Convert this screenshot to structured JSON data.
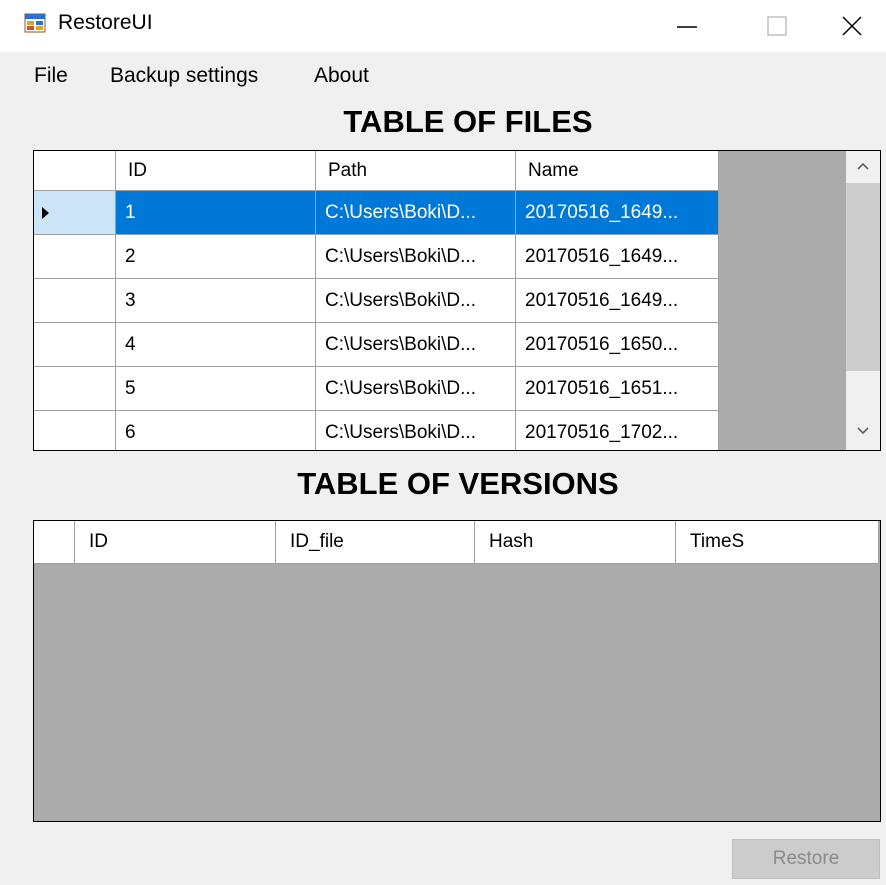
{
  "window": {
    "title": "RestoreUI",
    "icon": "app-form-icon"
  },
  "titlebar_buttons": {
    "minimize_icon": "minimize-icon",
    "maximize_icon": "maximize-icon",
    "close_icon": "close-icon"
  },
  "menu": [
    "File",
    "Backup settings",
    "About"
  ],
  "files": {
    "heading": "TABLE OF FILES",
    "columns": [
      "ID",
      "Path",
      "Name"
    ],
    "rows": [
      [
        "1",
        "C:\\Users\\Boki\\D...",
        "20170516_1649..."
      ],
      [
        "2",
        "C:\\Users\\Boki\\D...",
        "20170516_1649..."
      ],
      [
        "3",
        "C:\\Users\\Boki\\D...",
        "20170516_1649..."
      ],
      [
        "4",
        "C:\\Users\\Boki\\D...",
        "20170516_1650..."
      ],
      [
        "5",
        "C:\\Users\\Boki\\D...",
        "20170516_1651..."
      ],
      [
        "6",
        "C:\\Users\\Boki\\D...",
        "20170516_1702..."
      ]
    ],
    "selected_row": 0
  },
  "versions": {
    "heading": "TABLE OF VERSIONS",
    "columns": [
      "ID",
      "ID_file",
      "Hash",
      "TimeS"
    ]
  },
  "restore_label": "Restore",
  "colors": {
    "selection": "#0078d7",
    "selection_header": "#cce4f7",
    "grid_background": "#ababab",
    "window_bg": "#f0f0f0"
  }
}
